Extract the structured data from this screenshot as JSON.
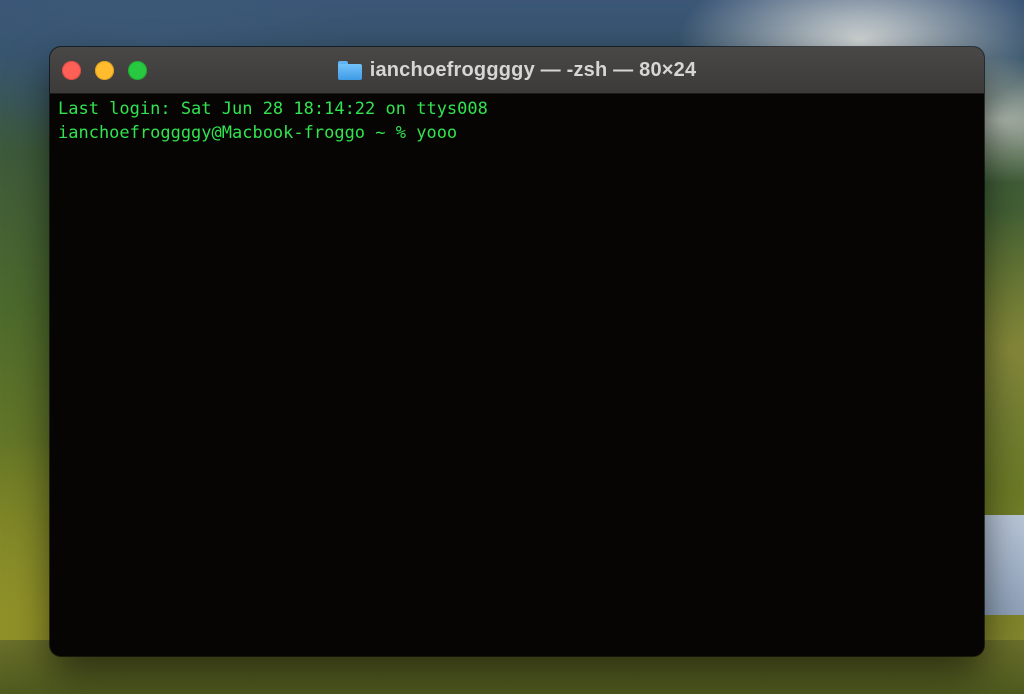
{
  "window": {
    "title": "ianchoefroggggy — -zsh — 80×24",
    "title_icon": "folder-icon",
    "traffic_lights": {
      "close_color": "#fe5f57",
      "minimize_color": "#febc2e",
      "maximize_color": "#28c840"
    }
  },
  "terminal": {
    "text_color": "#31e34f",
    "background_color": "#060504",
    "lines": [
      "Last login: Sat Jun 28 18:14:22 on ttys008",
      "ianchoefroggggy@Macbook-froggo ~ % yooo"
    ]
  }
}
